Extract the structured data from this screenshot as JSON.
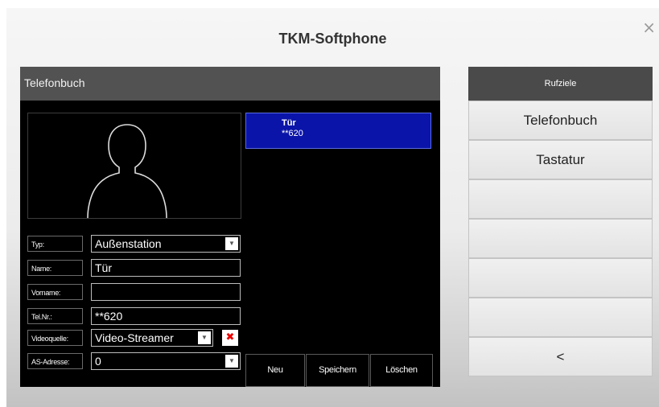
{
  "window": {
    "title": "TKM-Softphone",
    "close_label": "×"
  },
  "phonebook": {
    "title": "Telefonbuch",
    "fields": {
      "typ": {
        "label": "Typ:",
        "value": "Außenstation"
      },
      "name": {
        "label": "Name:",
        "value": "Tür"
      },
      "vorname": {
        "label": "Vorname:",
        "value": ""
      },
      "telnr": {
        "label": "Tel.Nr.:",
        "value": "**620"
      },
      "videoquelle": {
        "label": "Videoquelle:",
        "value": "Video-Streamer"
      },
      "as_adresse": {
        "label": "AS-Adresse:",
        "value": "0"
      }
    },
    "entries": [
      {
        "name": "Tür",
        "number": "**620",
        "selected": true
      }
    ],
    "actions": {
      "new": "Neu",
      "save": "Speichern",
      "delete": "Löschen"
    }
  },
  "nav": {
    "header": "Rufziele",
    "items": [
      "Telefonbuch",
      "Tastatur",
      "",
      "",
      "",
      "",
      "<"
    ]
  },
  "colors": {
    "selected_entry": "#0a14a8",
    "panel_header": "#525252",
    "delete_icon": "#ee0000"
  },
  "icons": {
    "dropdown": "▼",
    "remove": "✖"
  }
}
